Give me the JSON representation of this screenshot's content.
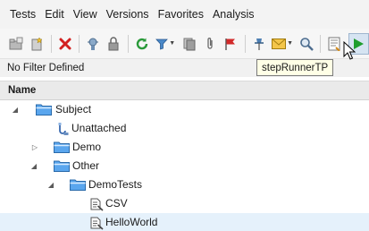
{
  "menu": [
    "Tests",
    "Edit",
    "View",
    "Versions",
    "Favorites",
    "Analysis"
  ],
  "toolbar": {
    "icons": [
      "new-folder-icon",
      "new-test-icon",
      "delete-icon",
      "debug-icon",
      "lock-icon",
      "refresh-icon",
      "filter-icon",
      "copy-icon",
      "attachment-icon",
      "flag-icon",
      "pin-icon",
      "mail-icon",
      "find-icon",
      "report-icon",
      "run-icon"
    ],
    "tooltip": "stepRunnerTP"
  },
  "filter_status": "No Filter Defined",
  "column_header": "Name",
  "tree": [
    {
      "label": "Subject",
      "icon": "folder-icon",
      "level": 0,
      "state": "expanded"
    },
    {
      "label": "Unattached",
      "icon": "unattached-icon",
      "level": 1,
      "state": "leaf"
    },
    {
      "label": "Demo",
      "icon": "folder-icon",
      "level": 1,
      "state": "collapsed"
    },
    {
      "label": "Other",
      "icon": "folder-icon",
      "level": 1,
      "state": "expanded"
    },
    {
      "label": "DemoTests",
      "icon": "folder-icon",
      "level": 2,
      "state": "expanded"
    },
    {
      "label": "CSV",
      "icon": "test-script-icon",
      "level": 3,
      "state": "leaf"
    },
    {
      "label": "HelloWorld",
      "icon": "test-script-icon",
      "level": 3,
      "state": "leaf",
      "selected": true
    }
  ],
  "colors": {
    "selection": "#e5f1fb",
    "folder": "#3a8ee0",
    "run_green": "#1e9e2e",
    "delete_red": "#d22020"
  }
}
